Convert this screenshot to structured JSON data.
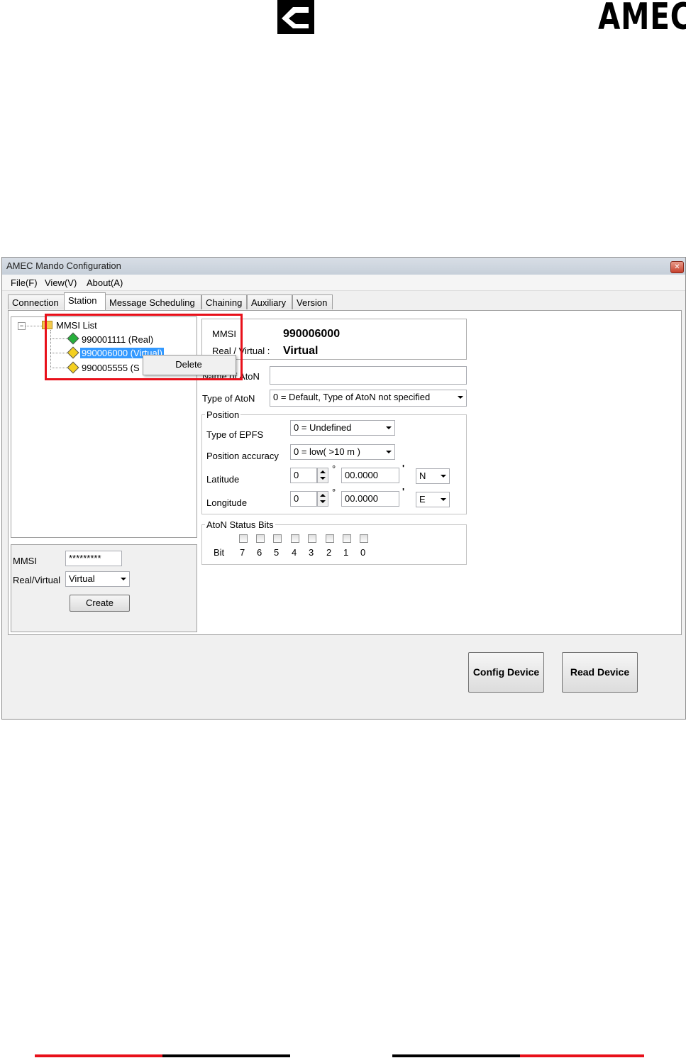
{
  "logo": {
    "text": "AMEC"
  },
  "window": {
    "title": "AMEC Mando Configuration",
    "close_icon": "close-icon",
    "menu": [
      "File(F)",
      "View(V)",
      "About(A)"
    ],
    "tabs": [
      "Connection",
      "Station",
      "Message Scheduling",
      "Chaining",
      "Auxiliary",
      "Version"
    ],
    "active_tab": "Station"
  },
  "tree": {
    "root_label": "MMSI List",
    "items": [
      {
        "label": "990001111  (Real)",
        "icon": "green-diamond-icon"
      },
      {
        "label": "990006000  (Virtual)",
        "icon": "yellow-diamond-icon",
        "selected": true
      },
      {
        "label": "990005555  (S",
        "icon": "yellow-diamond-icon"
      }
    ],
    "context_menu": [
      "Delete"
    ]
  },
  "create": {
    "mmsi_label": "MMSI",
    "mmsi_value": "*********",
    "real_virtual_label": "Real/Virtual",
    "real_virtual_value": "Virtual",
    "create_button": "Create"
  },
  "detail": {
    "mmsi_label": "MMSI",
    "mmsi_value": "990006000",
    "real_virtual_label": "Real / Virtual :",
    "real_virtual_value": "Virtual",
    "name_label": "Name of AtoN",
    "name_value": "",
    "type_label": "Type of AtoN",
    "type_value": "0 = Default, Type of AtoN not specified",
    "position": {
      "legend": "Position",
      "epfs_label": "Type of EPFS",
      "epfs_value": "0 = Undefined",
      "accuracy_label": "Position accuracy",
      "accuracy_value": "0 = low( >10 m )",
      "lat_label": "Latitude",
      "lat_deg": "0",
      "lat_min": "00.0000",
      "lat_hemi": "N",
      "lon_label": "Longitude",
      "lon_deg": "0",
      "lon_min": "00.0000",
      "lon_hemi": "E",
      "deg_symbol": "°",
      "min_symbol": "'"
    },
    "status": {
      "legend": "AtoN Status Bits",
      "bit_label": "Bit",
      "bits": [
        "7",
        "6",
        "5",
        "4",
        "3",
        "2",
        "1",
        "0"
      ]
    }
  },
  "buttons": {
    "config": "Config Device",
    "read": "Read Device"
  },
  "colors": {
    "highlight_red": "#e8101a",
    "selection_blue": "#3399ff",
    "footer_red": "#e8101a",
    "footer_black": "#000000"
  }
}
